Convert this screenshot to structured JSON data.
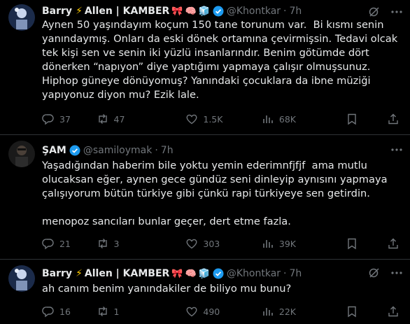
{
  "tweets": [
    {
      "author": "Barry",
      "author_rest": "Allen | KAMBER",
      "emojis": [
        "🎀",
        "🧠",
        "🧊"
      ],
      "handle": "@Khontkar",
      "time": "7h",
      "text": "Aynen 50 yaşındayım koçum 150 tane torunum var.  Bi kısmı senin yanındaymış. Onları da eski dönek ortamına çevirmişsin. Tedavi olcak tek kişi sen ve senin iki yüzlü insanlarındır. Benim götümde dört dönerken “napıyon” diye yaptığımı yapmaya çalışır olmuşsunuz. Hiphop güneye dönüyomuş? Yanındaki çocuklara da ibne müziği yapıyonuz diyon mu? Ezik lale.",
      "replies": "37",
      "retweets": "47",
      "likes": "1.5K",
      "views": "68K"
    },
    {
      "author": "ŞAM",
      "handle": "@samiloymak",
      "time": "7h",
      "text": "Yaşadığından haberim bile yoktu yemin ederimnfjfjf  ama mutlu olucaksan eğer, aynen gece gündüz seni dinleyip aynısını yapmaya çalışıyorum bütün türkiye gibi çünkü rapi türkiyeye sen getirdin.\n\nmenopoz sancıları bunlar geçer, dert etme fazla.",
      "replies": "21",
      "retweets": "3",
      "likes": "303",
      "views": "39K"
    },
    {
      "author": "Barry",
      "author_rest": "Allen | KAMBER",
      "emojis": [
        "🎀",
        "🧠",
        "🧊"
      ],
      "handle": "@Khontkar",
      "time": "7h",
      "text": "ah canım benim yanındakiler de biliyo mu bunu?",
      "replies": "16",
      "retweets": "1",
      "likes": "490",
      "views": "22K"
    }
  ],
  "separator": "·",
  "colors": {
    "background": "#000000",
    "text": "#e7e9ea",
    "muted": "#71767b",
    "verified": "#1d9bf0",
    "divider": "#2f3336"
  },
  "icons": [
    "verified-badge-icon",
    "grok-icon",
    "more-icon",
    "reply-icon",
    "retweet-icon",
    "like-icon",
    "views-icon",
    "bookmark-icon",
    "share-icon"
  ]
}
